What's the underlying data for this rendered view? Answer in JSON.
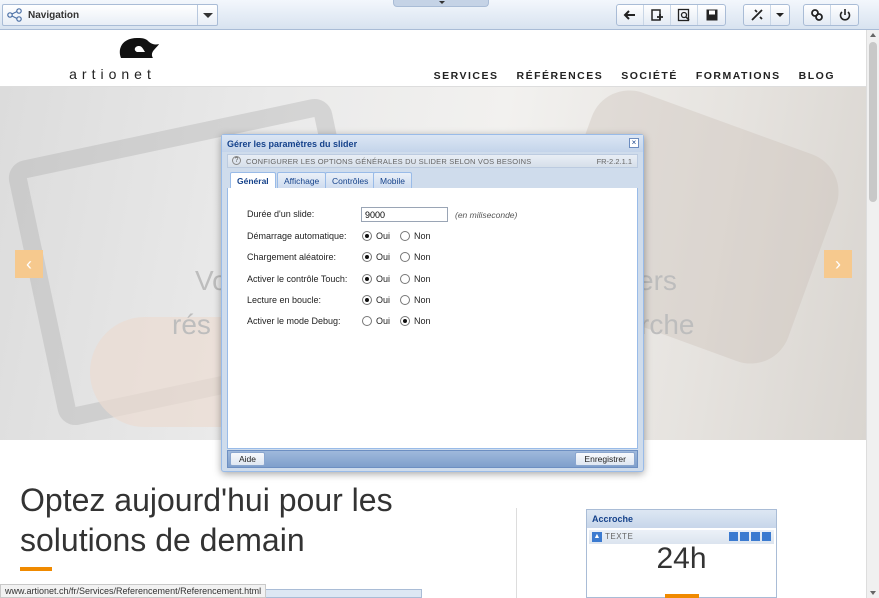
{
  "cms_bar": {
    "navigation_label": "Navigation",
    "icons": [
      "back-arrow-icon",
      "add-page-icon",
      "preview-icon",
      "save-icon",
      "tools-icon",
      "tools-dropdown-icon",
      "link-icon",
      "power-icon"
    ]
  },
  "site": {
    "logo_text": "artionet",
    "nav": [
      "SERVICES",
      "RÉFÉRENCES",
      "SOCIÉTÉ",
      "FORMATIONS",
      "BLOG"
    ],
    "hero_lines": [
      "Vo",
      "ers",
      "rés",
      "rche"
    ],
    "prev_arrow": "‹",
    "next_arrow": "›",
    "headline_line1": "Optez aujourd'hui pour les",
    "headline_line2": "solutions de demain",
    "accroche": {
      "title": "Accroche",
      "label": "TEXTE",
      "value": "24h"
    },
    "status_url": "www.artionet.ch/fr/Services/Referencement/Referencement.html"
  },
  "dialog": {
    "title": "Gérer les paramètres du slider",
    "close": "×",
    "subtitle": "CONFIGURER LES OPTIONS GÉNÉRALES DU SLIDER SELON VOS BESOINS",
    "version": "FR-2.2.1.1",
    "tabs": [
      "Général",
      "Affichage",
      "Contrôles",
      "Mobile"
    ],
    "active_tab": "Général",
    "duration_label": "Durée d'un slide:",
    "duration_value": "9000",
    "duration_hint": "(en miliseconde)",
    "option_yes": "Oui",
    "option_no": "Non",
    "options": [
      {
        "label": "Démarrage automatique:",
        "selected": "Oui"
      },
      {
        "label": "Chargement aléatoire:",
        "selected": "Oui"
      },
      {
        "label": "Activer le contrôle Touch:",
        "selected": "Oui"
      },
      {
        "label": "Lecture en boucle:",
        "selected": "Oui"
      },
      {
        "label": "Activer le mode Debug:",
        "selected": "Non"
      }
    ],
    "help_button": "Aide",
    "save_button": "Enregistrer"
  },
  "colors": {
    "accent_orange": "#f08a00",
    "dialog_title_blue": "#15428b",
    "arrow_bg": "#f6c98e"
  }
}
